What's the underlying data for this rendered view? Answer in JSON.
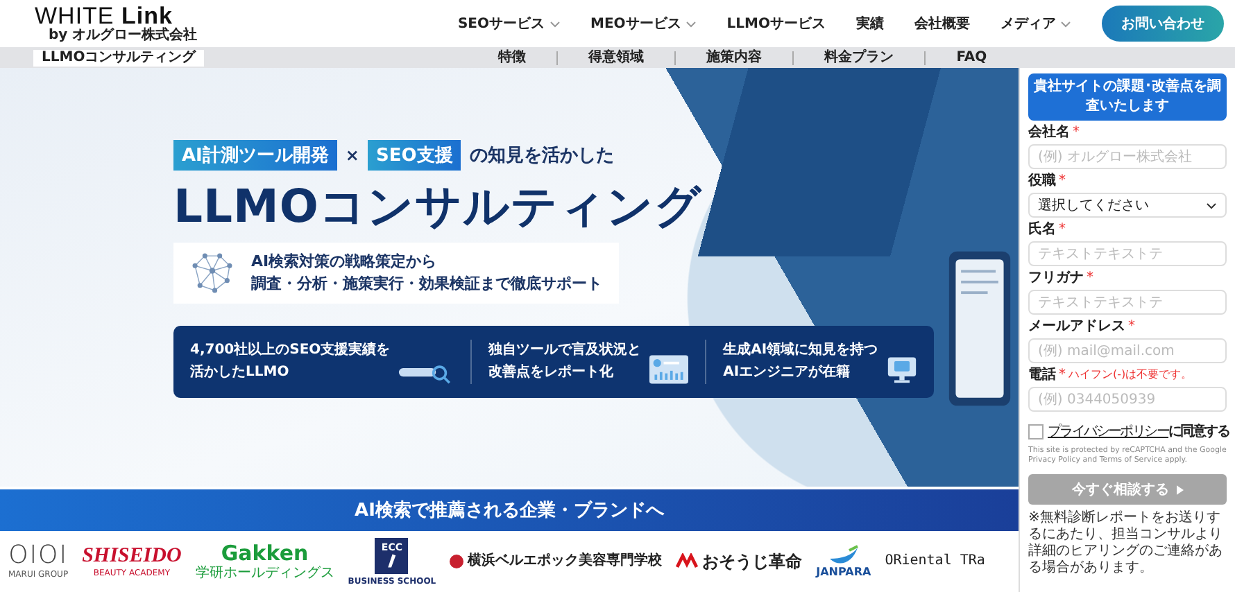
{
  "header": {
    "logo": "WHITE **Link**",
    "logo_sub": "by オルグロー株式会社",
    "nav": [
      {
        "label": "SEOサービス",
        "dropdown": true
      },
      {
        "label": "MEOサービス",
        "dropdown": true
      },
      {
        "label": "LLMOサービス",
        "dropdown": false
      },
      {
        "label": "実績",
        "dropdown": false
      },
      {
        "label": "会社概要",
        "dropdown": false
      },
      {
        "label": "メディア",
        "dropdown": true
      }
    ],
    "cta": "お問い合わせ"
  },
  "subnav": {
    "page_label": "LLMOコンサルティング",
    "links": [
      "特徴",
      "得意領域",
      "施策内容",
      "料金プラン",
      "FAQ"
    ]
  },
  "hero": {
    "tags": [
      "AI計測ツール開発",
      "SEO支援"
    ],
    "joiner": "×",
    "suffix": "の知見を活かした",
    "title": "LLMOコンサルティング",
    "card_lines": [
      "AI検索対策の戦略策定から",
      "調査・分析・施策実行・効果検証まで徹底サポート"
    ],
    "stats": [
      {
        "lines": [
          "4,700社以上のSEO支援実績を",
          "活かしたLLMO"
        ],
        "kind": "search"
      },
      {
        "lines": [
          "独自ツールで言及状況と",
          "改善点をレポート化"
        ],
        "kind": "report"
      },
      {
        "lines": [
          "生成AI領域に知見を持つ",
          "AIエンジニアが在籍"
        ],
        "kind": "monitor"
      }
    ]
  },
  "banner": "AI検索で推薦される企業・ブランドへ",
  "logos": [
    {
      "kind": "thin",
      "name": "OIOI",
      "sub": "MARUI GROUP"
    },
    {
      "kind": "red",
      "name": "SHISEIDO",
      "sub": "BEAUTY ACADEMY"
    },
    {
      "kind": "green",
      "name": "Gakken",
      "sub": "学研ホールディングス"
    },
    {
      "kind": "badge",
      "name": "ECC",
      "sub": "BUSINESS SCHOOL"
    },
    {
      "kind": "school",
      "name": "横浜ベルエポック美容専門学校"
    },
    {
      "kind": "clean",
      "name": "おそうじ革命"
    },
    {
      "kind": "wave",
      "name": "JANPARA"
    },
    {
      "kind": "mono",
      "name": "ORiental TRa"
    }
  ],
  "form": {
    "title": "貴社サイトの課題･改善点を調査いたします",
    "fields": [
      {
        "kind": "input",
        "label": "会社名",
        "required_mark": "*",
        "placeholder": "(例) オルグロー株式会社"
      },
      {
        "kind": "select",
        "label": "役職",
        "required_mark": "*",
        "value": "選択してください"
      },
      {
        "kind": "input",
        "label": "氏名",
        "required_mark": "*",
        "placeholder": "テキストテキストテ"
      },
      {
        "kind": "input",
        "label": "フリガナ",
        "required_mark": "*",
        "placeholder": "テキストテキストテ"
      },
      {
        "kind": "input",
        "label": "メールアドレス",
        "required_mark": "*",
        "placeholder": "(例) mail@mail.com"
      },
      {
        "kind": "input",
        "label": "電話",
        "required_mark": "*",
        "note": "ハイフン(-)は不要です。",
        "placeholder": "(例) 0344050939"
      }
    ],
    "privacy": {
      "checked": false,
      "link": "プライバシーポリシー",
      "text": "に同意する"
    },
    "recaptcha": "This site is protected by reCAPTCHA and the Google Privacy Policy and Terms of Service apply.",
    "submit": {
      "label": "今すぐ相談する",
      "disabled": true
    },
    "note": "※無料診断レポートをお送りするにあたり、担当コンサルより詳細のヒアリングのご連絡がある場合があります。"
  }
}
